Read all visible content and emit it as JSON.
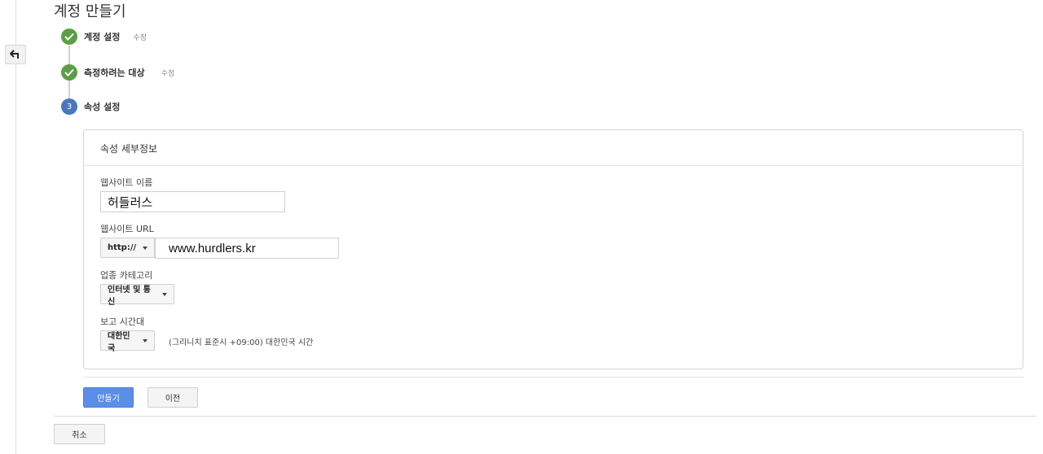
{
  "page": {
    "title": "계정 만들기",
    "back_icon": "arrow-left-icon"
  },
  "steps": [
    {
      "label": "계정 설정",
      "edit": "수정",
      "status": "done",
      "icon": "check-icon"
    },
    {
      "label": "측정하려는 대상",
      "edit": "수정",
      "status": "done",
      "icon": "check-icon"
    },
    {
      "label": "속성 설정",
      "number": "3",
      "status": "current"
    }
  ],
  "card": {
    "header": "속성 세부정보",
    "website_name": {
      "label": "웹사이트 이름",
      "value": "허들러스"
    },
    "website_url": {
      "label": "웹사이트 URL",
      "protocol": "http://",
      "value": "www.hurdlers.kr"
    },
    "industry": {
      "label": "업종 카테고리",
      "value": "인터넷 및 통신"
    },
    "timezone": {
      "label": "보고 시간대",
      "country": "대한민국",
      "note": "(그리니치 표준시 +09:00) 대한민국 시간"
    }
  },
  "actions": {
    "create": "만들기",
    "previous": "이전",
    "cancel": "취소"
  },
  "colors": {
    "done": "#5b9e47",
    "current": "#4a78b8",
    "primary_button": "#5b8ee6"
  }
}
